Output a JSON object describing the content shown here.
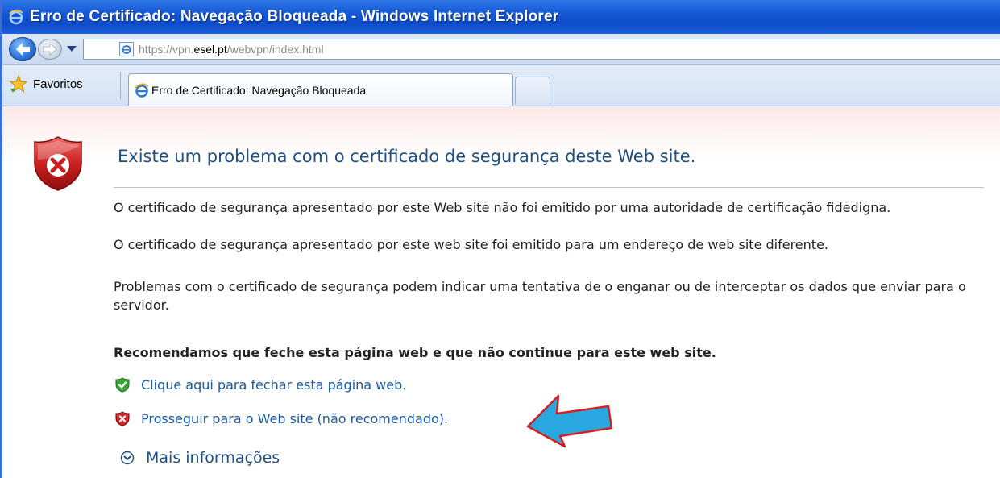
{
  "window": {
    "title": "Erro de Certificado: Navegação Bloqueada - Windows Internet Explorer"
  },
  "address_bar": {
    "url_prefix": "https://vpn.",
    "url_host": "esel.pt",
    "url_path": "/webvpn/index.html"
  },
  "toolbar": {
    "favorites_label": "Favoritos"
  },
  "tabs": [
    {
      "label": "Erro de Certificado: Navegação Bloqueada",
      "active": true
    }
  ],
  "page": {
    "headline": "Existe um problema com o certificado de segurança deste Web site.",
    "paragraph1": "O certificado de segurança apresentado por este Web site não foi emitido por uma autoridade de certificação fidedigna.",
    "paragraph2": "O certificado de segurança apresentado por este web site foi emitido para um endereço de web site diferente.",
    "paragraph3": "Problemas com o certificado de segurança podem indicar uma tentativa de o enganar ou de interceptar os dados que enviar para o servidor.",
    "recommendation": "Recomendamos que feche esta página web e que não continue para este web site.",
    "close_link": "Clique aqui para fechar esta página web.",
    "continue_link": "Prosseguir para o Web site (não recomendado).",
    "more_info": "Mais informações"
  },
  "colors": {
    "title_bar": "#1557d6",
    "link": "#1a5aa6",
    "headline": "#1f4f86",
    "error_shield": "#cc2a2a",
    "ok_shield": "#3aa53a",
    "annotation_arrow": "#29a8e0",
    "annotation_arrow_border": "#d42020"
  },
  "icons": {
    "title": "ie-logo-icon",
    "back": "back-arrow-icon",
    "forward": "forward-arrow-icon",
    "favorites": "star-icon",
    "error": "error-shield-icon",
    "ok": "ok-shield-icon",
    "more": "chevron-circle-down-icon",
    "annotation": "pointing-arrow-icon"
  }
}
